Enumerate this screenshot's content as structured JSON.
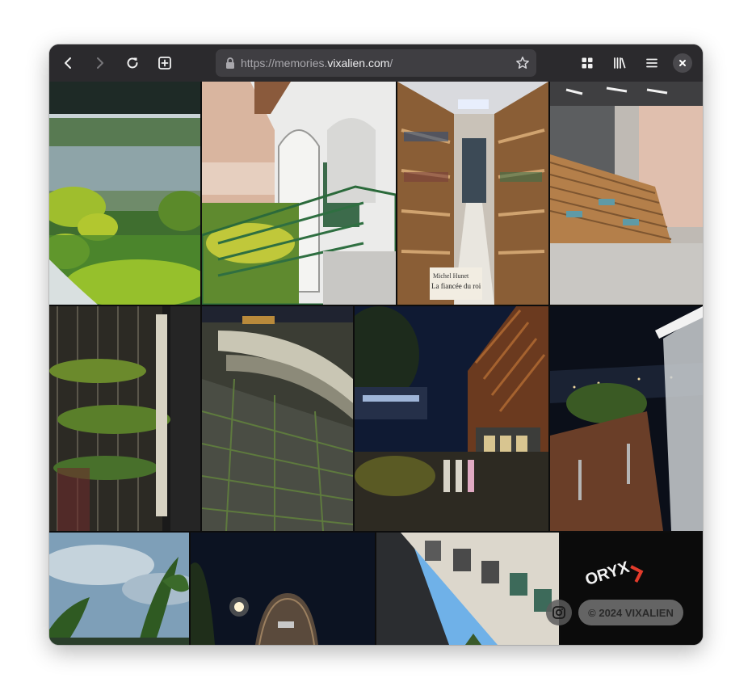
{
  "browser": {
    "url_scheme": "https://memories.",
    "url_host": "vixalien.com",
    "url_path": "/",
    "icons": {
      "back": "arrow-left-icon",
      "forward": "arrow-right-icon",
      "reload": "reload-icon",
      "new_tab": "new-tab-icon",
      "lock": "lock-icon",
      "bookmark": "star-icon",
      "grid": "grid-icon",
      "library": "library-icon",
      "menu": "hamburger-menu-icon",
      "close": "close-icon"
    },
    "colors": {
      "toolbar": "#2b2a2d",
      "urlbar": "#3f3e42"
    }
  },
  "gallery": {
    "photos": [
      {
        "subject": "lakeside-garden"
      },
      {
        "subject": "veranda-sunset"
      },
      {
        "subject": "library-aisle",
        "sign_author": "Michel Hunet",
        "sign_title": "La fiancée du roi"
      },
      {
        "subject": "wooden-amphitheater"
      },
      {
        "subject": "night-building-plants"
      },
      {
        "subject": "night-stone-steps"
      },
      {
        "subject": "night-courtyard"
      },
      {
        "subject": "night-street-view"
      },
      {
        "subject": "banana-leaves-sky"
      },
      {
        "subject": "night-dome-building"
      },
      {
        "subject": "building-corner-sky"
      },
      {
        "subject": "oryx-sign",
        "sign_text": "ORYX"
      }
    ]
  },
  "footer": {
    "instagram_icon": "instagram-icon",
    "copyright": "© 2024 VIXALIEN"
  }
}
